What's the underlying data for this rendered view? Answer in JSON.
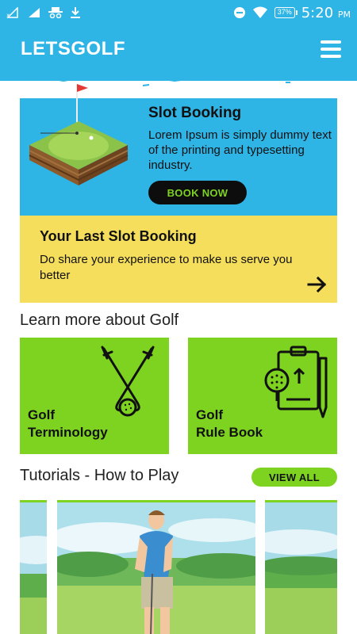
{
  "status_bar": {
    "time": "5:20",
    "ampm": "PM",
    "battery": "37%"
  },
  "app": {
    "title": "LETSGOLF"
  },
  "booking": {
    "title": "Slot Booking",
    "description": "Lorem Ipsum is simply dummy text of the printing and typesetting industry.",
    "button_label": "BOOK NOW"
  },
  "last_booking": {
    "title": "Your Last Slot Booking",
    "description": "Do share your experience to make us serve you better"
  },
  "learn": {
    "section_title": "Learn more about Golf",
    "tiles": [
      {
        "line1": "Golf",
        "line2": "Terminology",
        "icon": "golf-clubs-icon"
      },
      {
        "line1": "Golf",
        "line2": "Rule Book",
        "icon": "rule-book-icon"
      }
    ]
  },
  "tutorials": {
    "section_title": "Tutorials - How to Play",
    "view_all_label": "VIEW ALL"
  },
  "colors": {
    "primary_blue": "#2fb4e6",
    "accent_green": "#7ed321",
    "highlight_yellow": "#f5de5c"
  }
}
